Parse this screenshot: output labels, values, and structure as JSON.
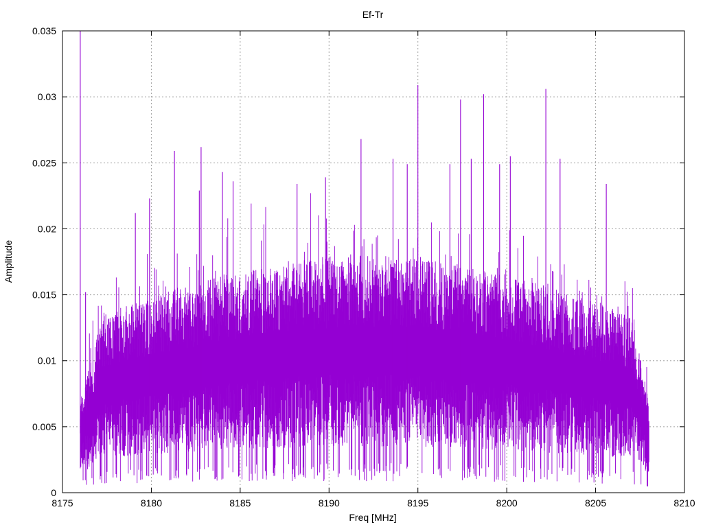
{
  "chart_data": {
    "type": "line",
    "title": "Ef-Tr",
    "xlabel": "Freq [MHz]",
    "ylabel": "Amplitude",
    "xlim": [
      8175,
      8210
    ],
    "ylim": [
      0,
      0.035
    ],
    "xticks": [
      "8175",
      "8180",
      "8185",
      "8190",
      "8195",
      "8200",
      "8205",
      "8210"
    ],
    "yticks": [
      "0",
      "0.005",
      "0.01",
      "0.015",
      "0.02",
      "0.025",
      "0.03",
      "0.035"
    ],
    "grid": true,
    "series": [
      {
        "color": "#9400d3",
        "x_range": [
          8176.0,
          8208.0
        ],
        "points": [
          [
            8176.0,
            0.035
          ],
          [
            8176.3,
            0.0152
          ],
          [
            8179.1,
            0.0212
          ],
          [
            8179.9,
            0.0223
          ],
          [
            8181.3,
            0.0259
          ],
          [
            8182.7,
            0.0229
          ],
          [
            8182.8,
            0.0262
          ],
          [
            8184.0,
            0.0243
          ],
          [
            8184.6,
            0.0236
          ],
          [
            8188.2,
            0.0234
          ],
          [
            8189.8,
            0.0239
          ],
          [
            8191.8,
            0.0268
          ],
          [
            8193.6,
            0.0253
          ],
          [
            8194.4,
            0.0249
          ],
          [
            8195.0,
            0.0309
          ],
          [
            8196.8,
            0.0249
          ],
          [
            8197.4,
            0.0298
          ],
          [
            8198.0,
            0.0253
          ],
          [
            8198.7,
            0.0302
          ],
          [
            8199.6,
            0.0249
          ],
          [
            8200.2,
            0.0255
          ],
          [
            8202.2,
            0.0306
          ],
          [
            8203.0,
            0.0253
          ],
          [
            8205.6,
            0.0234
          ],
          [
            8207.8,
            0.0002
          ]
        ]
      }
    ]
  }
}
